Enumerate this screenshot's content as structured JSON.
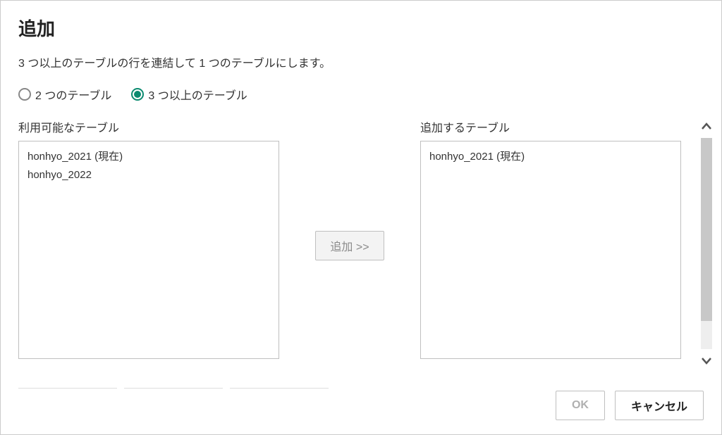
{
  "title": "追加",
  "description": "3 つ以上のテーブルの行を連結して 1 つのテーブルにします。",
  "radios": {
    "two_tables": "2 つのテーブル",
    "three_or_more": "3 つ以上のテーブル"
  },
  "labels": {
    "available": "利用可能なテーブル",
    "to_append": "追加するテーブル"
  },
  "available_tables": [
    "honhyo_2021 (現在)",
    "honhyo_2022"
  ],
  "append_tables": [
    "honhyo_2021 (現在)"
  ],
  "buttons": {
    "add": "追加 >>",
    "ok": "OK",
    "cancel": "キャンセル"
  }
}
